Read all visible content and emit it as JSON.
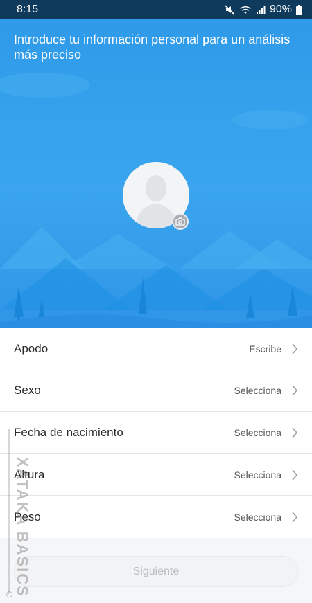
{
  "status_bar": {
    "time": "8:15",
    "battery": "90%"
  },
  "header": {
    "title": "Introduce tu información personal para un análisis más preciso"
  },
  "form": {
    "rows": [
      {
        "label": "Apodo",
        "value": "Escribe"
      },
      {
        "label": "Sexo",
        "value": "Selecciona"
      },
      {
        "label": "Fecha de nacimiento",
        "value": "Selecciona"
      },
      {
        "label": "Altura",
        "value": "Selecciona"
      },
      {
        "label": "Peso",
        "value": "Selecciona"
      }
    ]
  },
  "footer": {
    "next_label": "Siguiente"
  },
  "watermark": "XATAKA BASICS",
  "colors": {
    "hero": "#3aa5ee",
    "status_bar": "#0f3a5c"
  }
}
